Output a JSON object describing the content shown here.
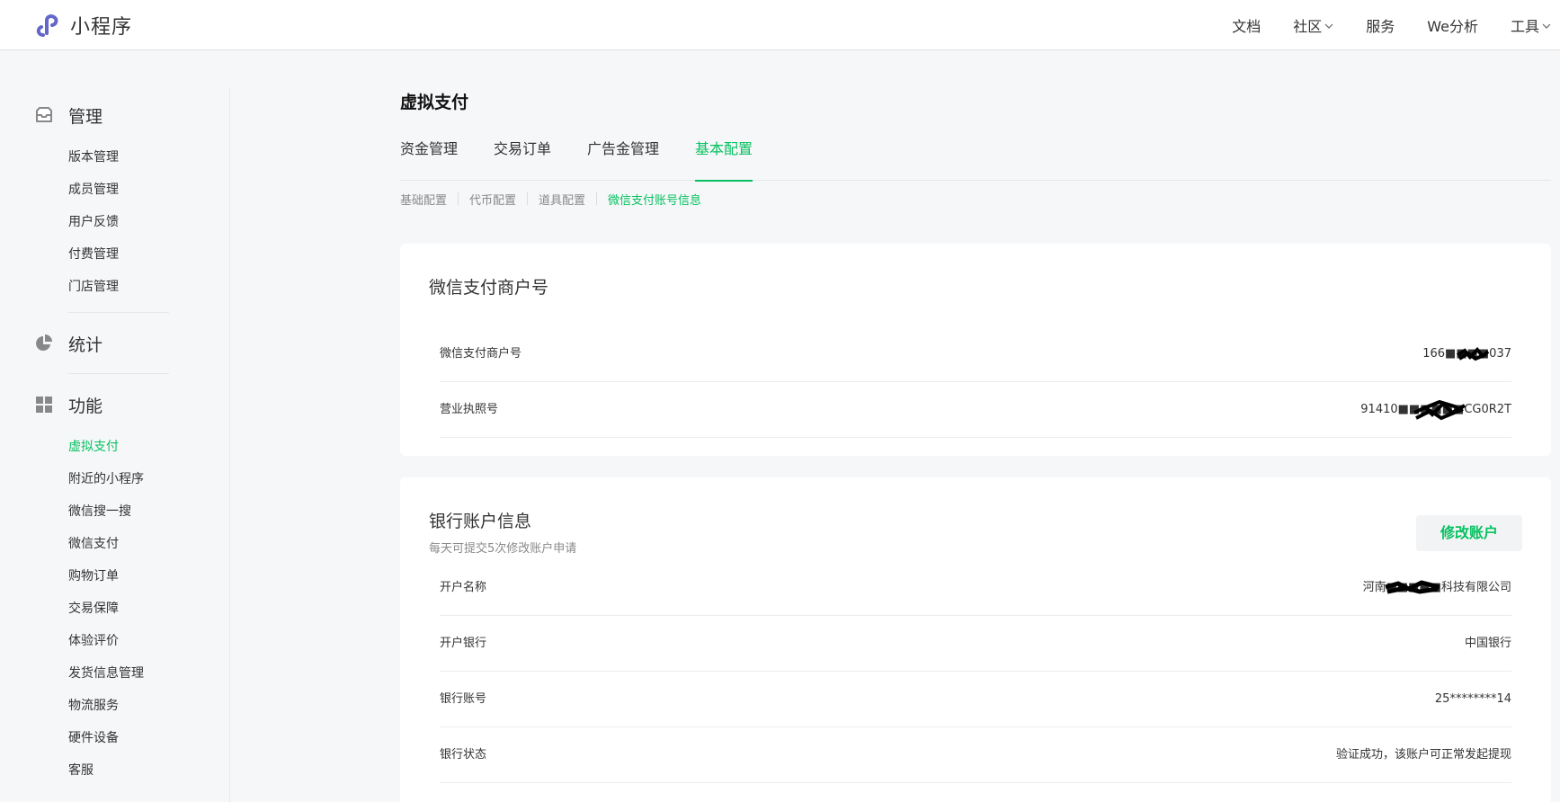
{
  "header": {
    "app_name": "小程序",
    "nav": [
      {
        "label": "文档",
        "has_dropdown": false
      },
      {
        "label": "社区",
        "has_dropdown": true
      },
      {
        "label": "服务",
        "has_dropdown": false
      },
      {
        "label": "We分析",
        "has_dropdown": false
      },
      {
        "label": "工具",
        "has_dropdown": true
      }
    ]
  },
  "sidebar": {
    "groups": [
      {
        "label": "管理",
        "icon": "inbox-icon",
        "items": [
          "版本管理",
          "成员管理",
          "用户反馈",
          "付费管理",
          "门店管理"
        ]
      },
      {
        "label": "统计",
        "icon": "pie-chart-icon",
        "items": []
      },
      {
        "label": "功能",
        "icon": "grid-icon",
        "items": [
          "虚拟支付",
          "附近的小程序",
          "微信搜一搜",
          "微信支付",
          "购物订单",
          "交易保障",
          "体验评价",
          "发货信息管理",
          "物流服务",
          "硬件设备",
          "客服"
        ]
      }
    ],
    "active_item": "虚拟支付"
  },
  "main": {
    "title": "虚拟支付",
    "tabs": [
      "资金管理",
      "交易订单",
      "广告金管理",
      "基本配置"
    ],
    "active_tab": "基本配置",
    "subtabs": [
      "基础配置",
      "代币配置",
      "道具配置",
      "微信支付账号信息"
    ],
    "active_subtab": "微信支付账号信息",
    "merchant_card": {
      "title": "微信支付商户号",
      "rows": [
        {
          "label": "微信支付商户号",
          "value": "166■■■■037"
        },
        {
          "label": "营业执照号",
          "value": "91410■■■■■■CG0R2T"
        }
      ]
    },
    "bank_card": {
      "title": "银行账户信息",
      "subtitle": "每天可提交5次修改账户申请",
      "edit_button": "修改账户",
      "rows": [
        {
          "label": "开户名称",
          "value": "河南■■■■■科技有限公司"
        },
        {
          "label": "开户银行",
          "value": "中国银行"
        },
        {
          "label": "银行账号",
          "value": "25********14"
        },
        {
          "label": "银行状态",
          "value": "验证成功，该账户可正常发起提现"
        }
      ]
    }
  },
  "colors": {
    "accent": "#07c160",
    "logo": "#6467c9"
  }
}
